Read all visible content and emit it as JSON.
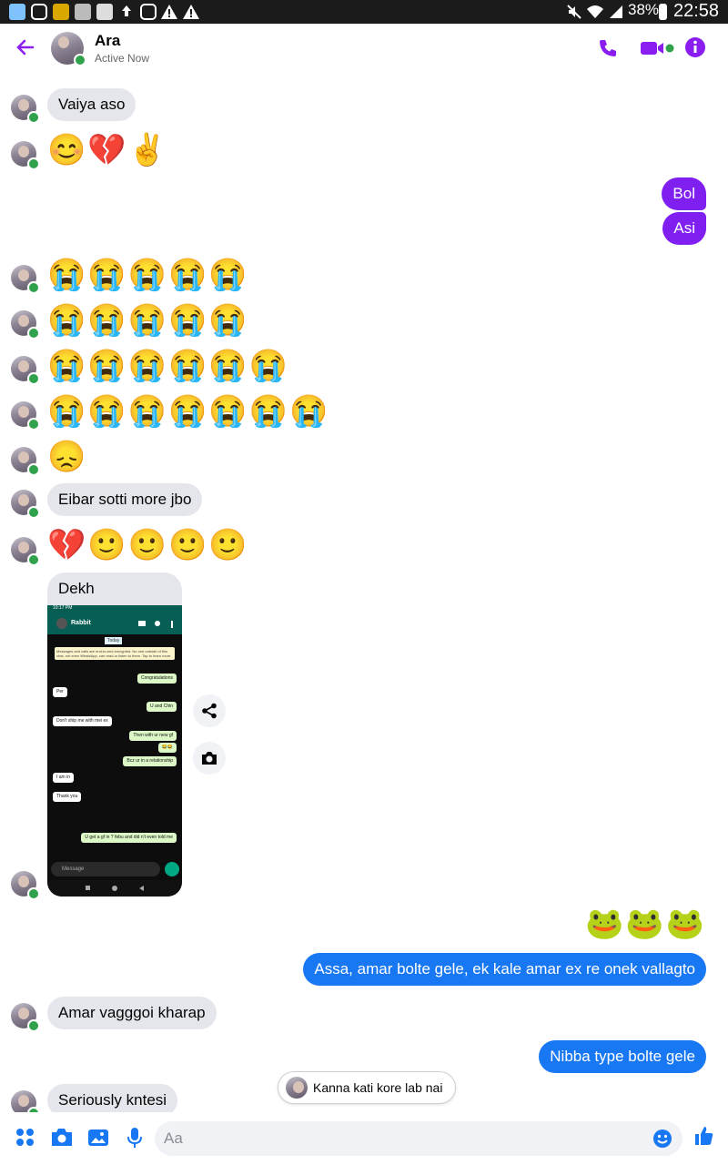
{
  "status_bar": {
    "battery": "38%",
    "time": "22:58"
  },
  "header": {
    "name": "Ara",
    "status": "Active Now"
  },
  "messages": {
    "m1": "Vaiya aso",
    "m2": "😊💔✌️",
    "m3": "Bol",
    "m4": "Asi",
    "m5": "😭😭😭😭😭",
    "m6": "😭😭😭😭😭",
    "m7": "😭😭😭😭😭😭",
    "m8": "😭😭😭😭😭😭😭",
    "m9": "😞",
    "m10": "Eibar sotti more jbo",
    "m11": "💔🙂🙂🙂🙂",
    "m12": "Dekh",
    "m13": "🐸🐸🐸",
    "m14": "Assa, amar bolte gele, ek kale amar ex re onek vallagto",
    "m15": "Amar vagggoi kharap",
    "m16": "Nibba type bolte gele",
    "m17": "Seriously kntesi"
  },
  "screenshot": {
    "time": "10:17 PM",
    "contact": "Rabbit",
    "date_chip": "Today",
    "encryption": "Messages and calls are end-to-end encrypted. No one outside of this chat, not even WhatsApp, can read or listen to them. Tap to learn more.",
    "rows": [
      {
        "side": "out",
        "text": "Congratulations"
      },
      {
        "side": "in",
        "text": "Per"
      },
      {
        "side": "out",
        "text": "U and Chin"
      },
      {
        "side": "in",
        "text": "Don't ship me with mei ex"
      },
      {
        "side": "out",
        "text": "Then with ur new gf"
      },
      {
        "side": "out",
        "text": "😂😂"
      },
      {
        "side": "out",
        "text": "Bcz ur in a relationship"
      },
      {
        "side": "in",
        "text": "I am in"
      },
      {
        "side": "in",
        "text": "Thank you"
      },
      {
        "side": "out",
        "text": "U get a gf in ? febu and did n't even told me"
      }
    ],
    "composer_placeholder": "Message"
  },
  "reply_preview": "Kanna kati kore lab nai",
  "composer": {
    "placeholder": "Aa"
  },
  "colors": {
    "accent_purple": "#7f1ff0",
    "accent_blue": "#1877f2",
    "active_green": "#31a24c"
  }
}
